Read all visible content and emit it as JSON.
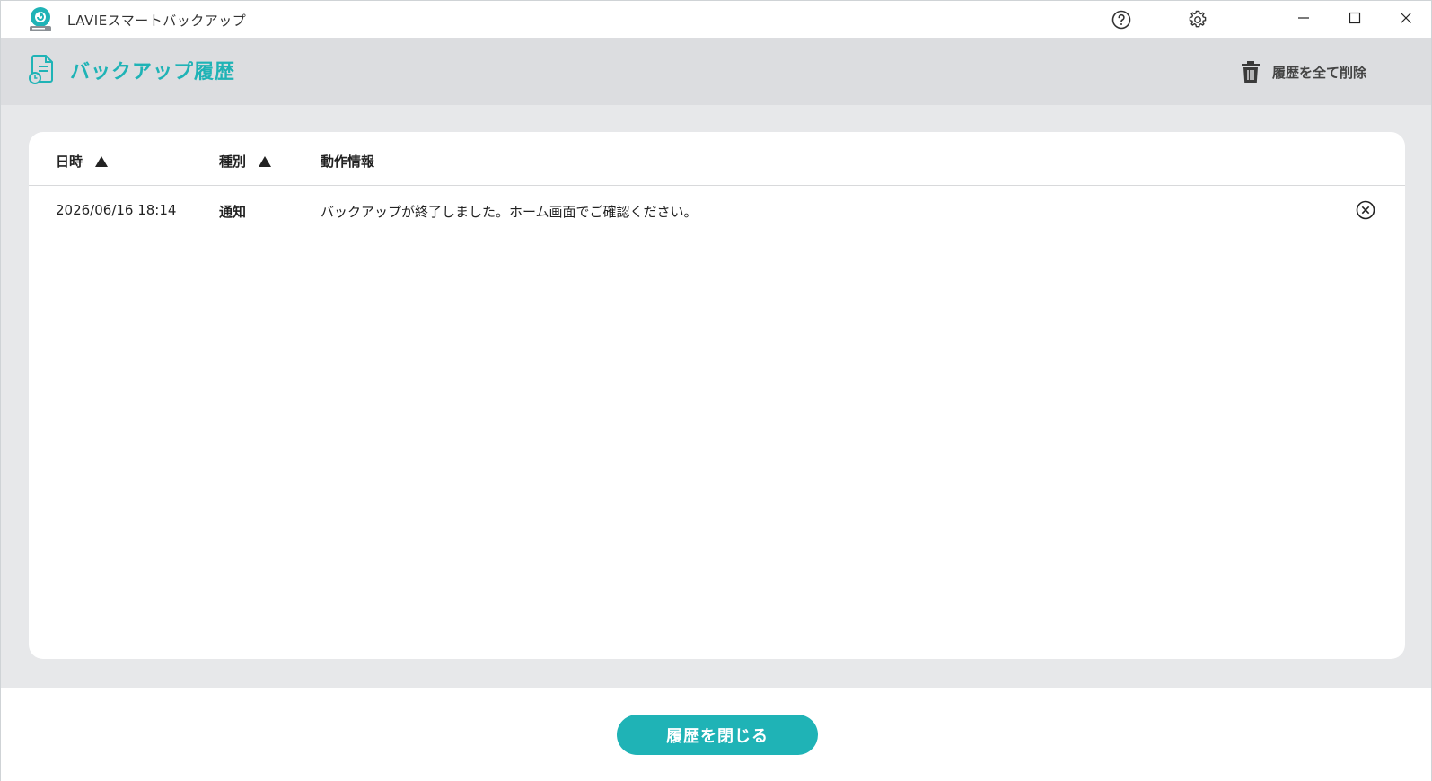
{
  "window": {
    "app_title": "LAVIEスマートバックアップ",
    "accent_color": "#1fb3b6"
  },
  "titlebar_icons": {
    "help": "help-icon",
    "settings": "gear-icon",
    "minimize": "minimize-icon",
    "maximize": "maximize-icon",
    "close": "close-icon"
  },
  "header": {
    "title": "バックアップ履歴",
    "delete_all_label": "履歴を全て削除"
  },
  "table": {
    "columns": [
      {
        "label": "日時",
        "sortable": true
      },
      {
        "label": "種別",
        "sortable": true
      },
      {
        "label": "動作情報",
        "sortable": false
      }
    ],
    "rows": [
      {
        "date": "2026/06/16 18:14",
        "type": "通知",
        "info": "バックアップが終了しました。ホーム画面でご確認ください。"
      }
    ]
  },
  "footer": {
    "close_label": "履歴を閉じる"
  }
}
